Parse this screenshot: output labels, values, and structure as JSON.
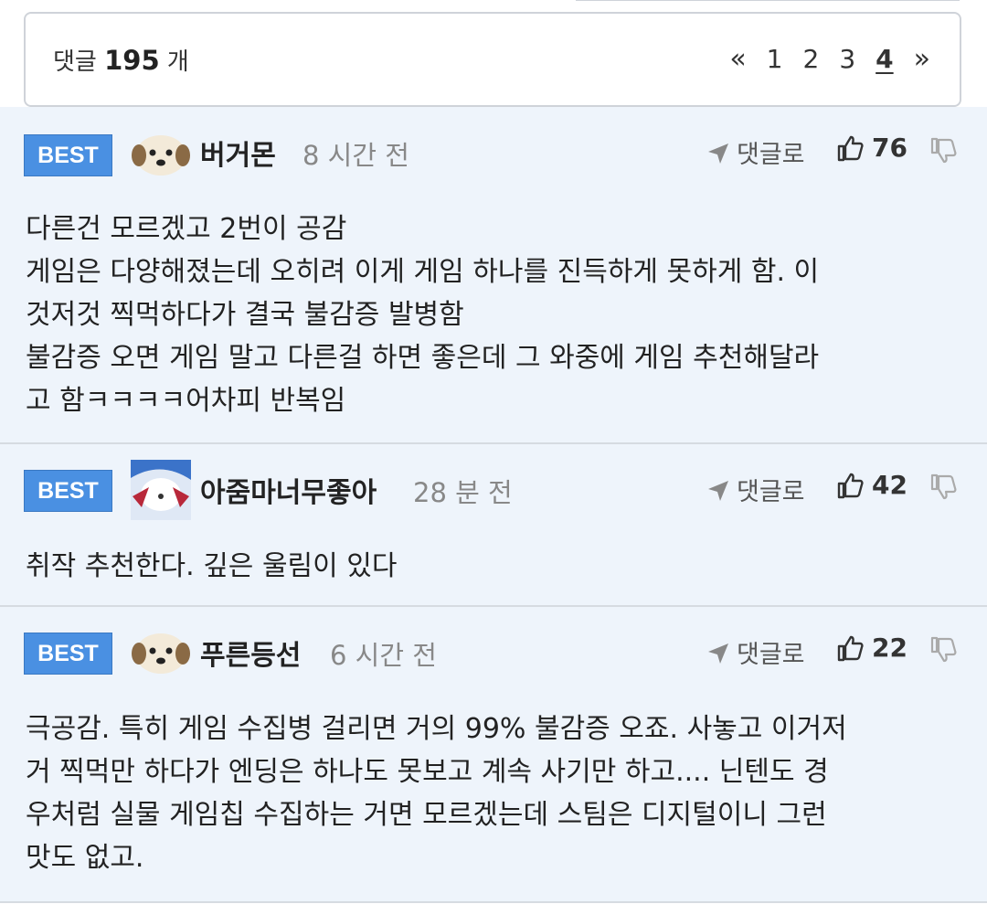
{
  "comment_count": {
    "prefix": "댓글",
    "count": "195",
    "suffix": "개"
  },
  "pagination": {
    "prev": "«",
    "pages": [
      "1",
      "2",
      "3",
      "4"
    ],
    "current": "4",
    "next": "»"
  },
  "comments": [
    {
      "badge": "BEST",
      "avatar": "puppy-avatar",
      "nickname": "버거몬",
      "time": "8 시간 전",
      "reply_label": "댓글로",
      "likes": "76",
      "lines": [
        "다른건 모르겠고 2번이 공감",
        "게임은 다양해졌는데 오히려 이게 게임 하나를 진득하게 못하게 함. 이",
        "것저것 찍먹하다가 결국 불감증 발병함",
        "불감증 오면 게임 말고 다른걸 하면 좋은데 그 와중에 게임 추천해달라",
        "고 함ㅋㅋㅋㅋ어차피 반복임"
      ]
    },
    {
      "badge": "BEST",
      "avatar": "creature-avatar",
      "nickname": "아줌마너무좋아",
      "time": "28 분 전",
      "reply_label": "댓글로",
      "likes": "42",
      "lines": [
        "취작 추천한다. 깊은 울림이 있다"
      ]
    },
    {
      "badge": "BEST",
      "avatar": "puppy-avatar",
      "nickname": "푸른등선",
      "time": "6 시간 전",
      "reply_label": "댓글로",
      "likes": "22",
      "lines": [
        "극공감. 특히 게임 수집병 걸리면 거의 99% 불감증 오죠. 사놓고 이거저",
        "거 찍먹만 하다가 엔딩은 하나도 못보고 계속 사기만 하고.... 닌텐도 경",
        "우처럼 실물 게임칩 수집하는 거면 모르겠는데 스팀은 디지털이니 그런",
        "맛도 없고."
      ]
    }
  ],
  "colors": {
    "best_badge": "#4a90e2",
    "comment_bg": "#eef4fb",
    "border": "#cfd3d9"
  }
}
